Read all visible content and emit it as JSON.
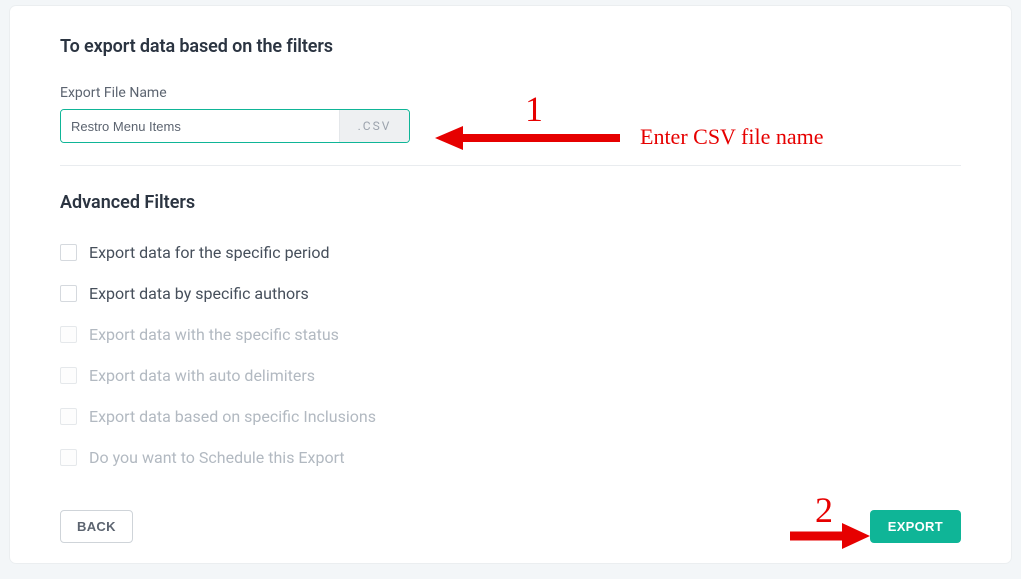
{
  "header": {
    "title": "To export data based on the filters"
  },
  "file": {
    "label": "Export File Name",
    "value": "Restro Menu Items",
    "extension": ".CSV"
  },
  "advanced": {
    "title": "Advanced Filters",
    "filters": [
      {
        "label": "Export data for the specific period",
        "enabled": true
      },
      {
        "label": "Export data by specific authors",
        "enabled": true
      },
      {
        "label": "Export data with the specific status",
        "enabled": false
      },
      {
        "label": "Export data with auto delimiters",
        "enabled": false
      },
      {
        "label": "Export data based on specific Inclusions",
        "enabled": false
      },
      {
        "label": "Do you want to Schedule this Export",
        "enabled": false
      }
    ]
  },
  "buttons": {
    "back": "BACK",
    "export": "EXPORT"
  },
  "annotations": {
    "num1": "1",
    "num2": "2",
    "label1": "Enter CSV file name"
  }
}
